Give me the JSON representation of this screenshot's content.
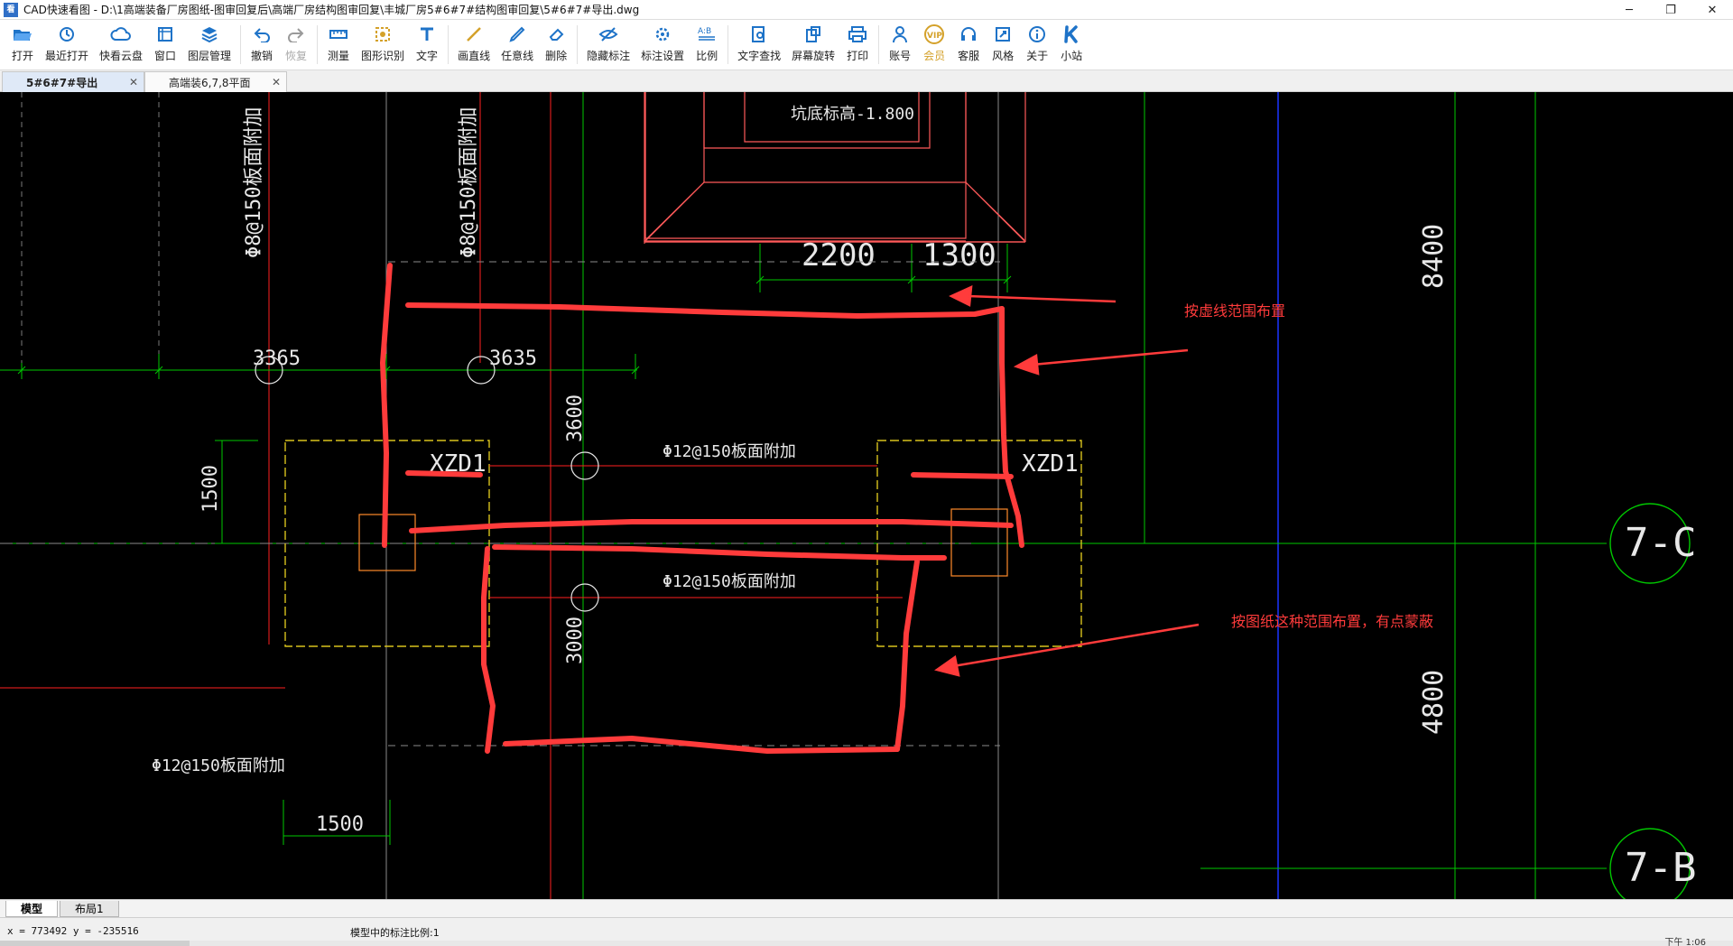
{
  "window": {
    "title": "CAD快速看图 - D:\\1高端装备厂房图纸-图审回复后\\高端厂房结构图审回复\\丰城厂房5#6#7#结构图审回复\\5#6#7#导出.dwg",
    "minimize": "─",
    "restore": "❐",
    "close": "✕"
  },
  "toolbar": [
    {
      "label": "打开",
      "icon": "folder-open-icon",
      "color": "#1e73c8"
    },
    {
      "label": "最近打开",
      "icon": "history-icon",
      "color": "#1e73c8"
    },
    {
      "label": "快看云盘",
      "icon": "cloud-icon",
      "color": "#1e73c8"
    },
    {
      "label": "窗口",
      "icon": "window-icon",
      "color": "#1e73c8"
    },
    {
      "label": "图层管理",
      "icon": "layers-icon",
      "color": "#1e73c8"
    },
    {
      "label": "撤销",
      "icon": "undo-icon",
      "color": "#1e73c8"
    },
    {
      "label": "恢复",
      "icon": "redo-icon",
      "color": "#9a9a9a",
      "disabled": true
    },
    {
      "label": "测量",
      "icon": "ruler-icon",
      "color": "#1e73c8"
    },
    {
      "label": "图形识别",
      "icon": "shape-recognition-icon",
      "color": "#d4a12a"
    },
    {
      "label": "文字",
      "icon": "text-icon",
      "color": "#1e73c8"
    },
    {
      "label": "画直线",
      "icon": "line-icon",
      "color": "#d4a12a"
    },
    {
      "label": "任意线",
      "icon": "freehand-icon",
      "color": "#1e73c8"
    },
    {
      "label": "删除",
      "icon": "eraser-icon",
      "color": "#1e73c8"
    },
    {
      "label": "隐藏标注",
      "icon": "hide-annotation-icon",
      "color": "#1e73c8"
    },
    {
      "label": "标注设置",
      "icon": "annotation-settings-icon",
      "color": "#1e73c8"
    },
    {
      "label": "比例",
      "icon": "scale-icon",
      "color": "#1e73c8"
    },
    {
      "label": "文字查找",
      "icon": "text-search-icon",
      "color": "#1e73c8"
    },
    {
      "label": "屏幕旋转",
      "icon": "rotate-screen-icon",
      "color": "#1e73c8"
    },
    {
      "label": "打印",
      "icon": "printer-icon",
      "color": "#1e73c8"
    },
    {
      "label": "账号",
      "icon": "user-icon",
      "color": "#1e73c8"
    },
    {
      "label": "会员",
      "icon": "vip-icon",
      "color": "#d4a12a",
      "vip": true
    },
    {
      "label": "客服",
      "icon": "headset-icon",
      "color": "#1e73c8"
    },
    {
      "label": "风格",
      "icon": "style-icon",
      "color": "#1e73c8"
    },
    {
      "label": "关于",
      "icon": "info-icon",
      "color": "#1e73c8"
    },
    {
      "label": "小站",
      "icon": "k-logo-icon",
      "color": "#1e73c8"
    }
  ],
  "tabs": [
    {
      "label": "5#6#7#导出",
      "active": true
    },
    {
      "label": "高端装6,7,8平面",
      "active": false
    }
  ],
  "drawing": {
    "dims": {
      "d2200": "2200",
      "d1300": "1300",
      "d3365": "3365",
      "d3635": "3635",
      "d3600": "3600",
      "d3000": "3000",
      "d1500v": "1500",
      "d1500h": "1500",
      "d8400": "8400",
      "d4800": "4800"
    },
    "rebar_labels": {
      "left_vertical_1": "Φ8@150板面附加",
      "left_vertical_2": "Φ8@150板面附加",
      "mid_upper": "Φ12@150板面附加",
      "mid_lower": "Φ12@150板面附加",
      "bottom_left": "Φ12@150板面附加"
    },
    "pit_label": "坑底标高-1.800",
    "column_left": "XZD1",
    "column_right": "XZD1",
    "axis_upper": "7-C",
    "axis_lower": "7-B",
    "annotation_1": "按虚线范围布置",
    "annotation_2": "按图纸这种范围布置，有点蒙蔽",
    "colors": {
      "annotation": "#ff3b3b",
      "dim": "#e8e8e8",
      "grid_green": "#00c800",
      "grid_blue": "#1a34ff",
      "column_yellow": "#d8c21c"
    }
  },
  "layout_tabs": [
    {
      "label": "模型",
      "active": true
    },
    {
      "label": "布局1",
      "active": false
    }
  ],
  "status": {
    "coords": "x = 773492  y = -235516",
    "scale_note": "模型中的标注比例:1",
    "corner_text": "下午 1:06"
  }
}
